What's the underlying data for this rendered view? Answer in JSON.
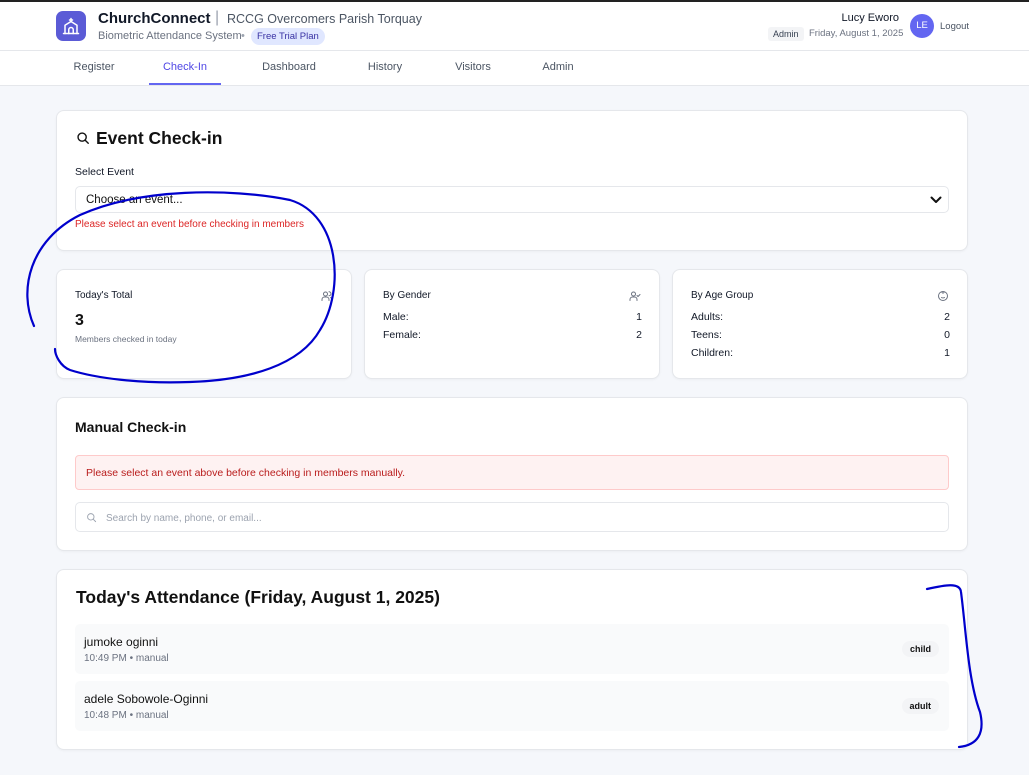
{
  "header": {
    "app_name": "ChurchConnect",
    "separator": "|",
    "parish": "RCCG Overcomers Parish Torquay",
    "subtitle": "Biometric Attendance System",
    "dot": "•",
    "plan": "Free Trial Plan",
    "user_name": "Lucy Eworo",
    "role": "Admin",
    "date": "Friday, August 1, 2025",
    "avatar_initials": "LE",
    "logout": "Logout"
  },
  "nav": {
    "tabs": [
      {
        "label": "Register"
      },
      {
        "label": "Check-In"
      },
      {
        "label": "Dashboard"
      },
      {
        "label": "History"
      },
      {
        "label": "Visitors"
      },
      {
        "label": "Admin"
      }
    ],
    "active": "Check-In"
  },
  "event_checkin": {
    "title": "Event Check-in",
    "select_label": "Select Event",
    "select_value": "Choose an event...",
    "error": "Please select an event before checking in members"
  },
  "stats": {
    "today_total": {
      "title": "Today's Total",
      "value": "3",
      "caption": "Members checked in today"
    },
    "by_gender": {
      "title": "By Gender",
      "rows": [
        {
          "label": "Male:",
          "value": "1"
        },
        {
          "label": "Female:",
          "value": "2"
        }
      ]
    },
    "by_age": {
      "title": "By Age Group",
      "rows": [
        {
          "label": "Adults:",
          "value": "2"
        },
        {
          "label": "Teens:",
          "value": "0"
        },
        {
          "label": "Children:",
          "value": "1"
        }
      ]
    }
  },
  "manual_checkin": {
    "title": "Manual Check-in",
    "alert": "Please select an event above before checking in members manually.",
    "search_placeholder": "Search by name, phone, or email..."
  },
  "attendance": {
    "title": "Today's Attendance (Friday, August 1, 2025)",
    "rows": [
      {
        "name": "jumoke oginni",
        "meta": "10:49 PM • manual",
        "badge": "child"
      },
      {
        "name": "adele Sobowole-Oginni",
        "meta": "10:48 PM • manual",
        "badge": "adult"
      }
    ]
  },
  "colors": {
    "accent": "#6366f1",
    "error": "#dc2626",
    "annotation": "#0000cc"
  }
}
